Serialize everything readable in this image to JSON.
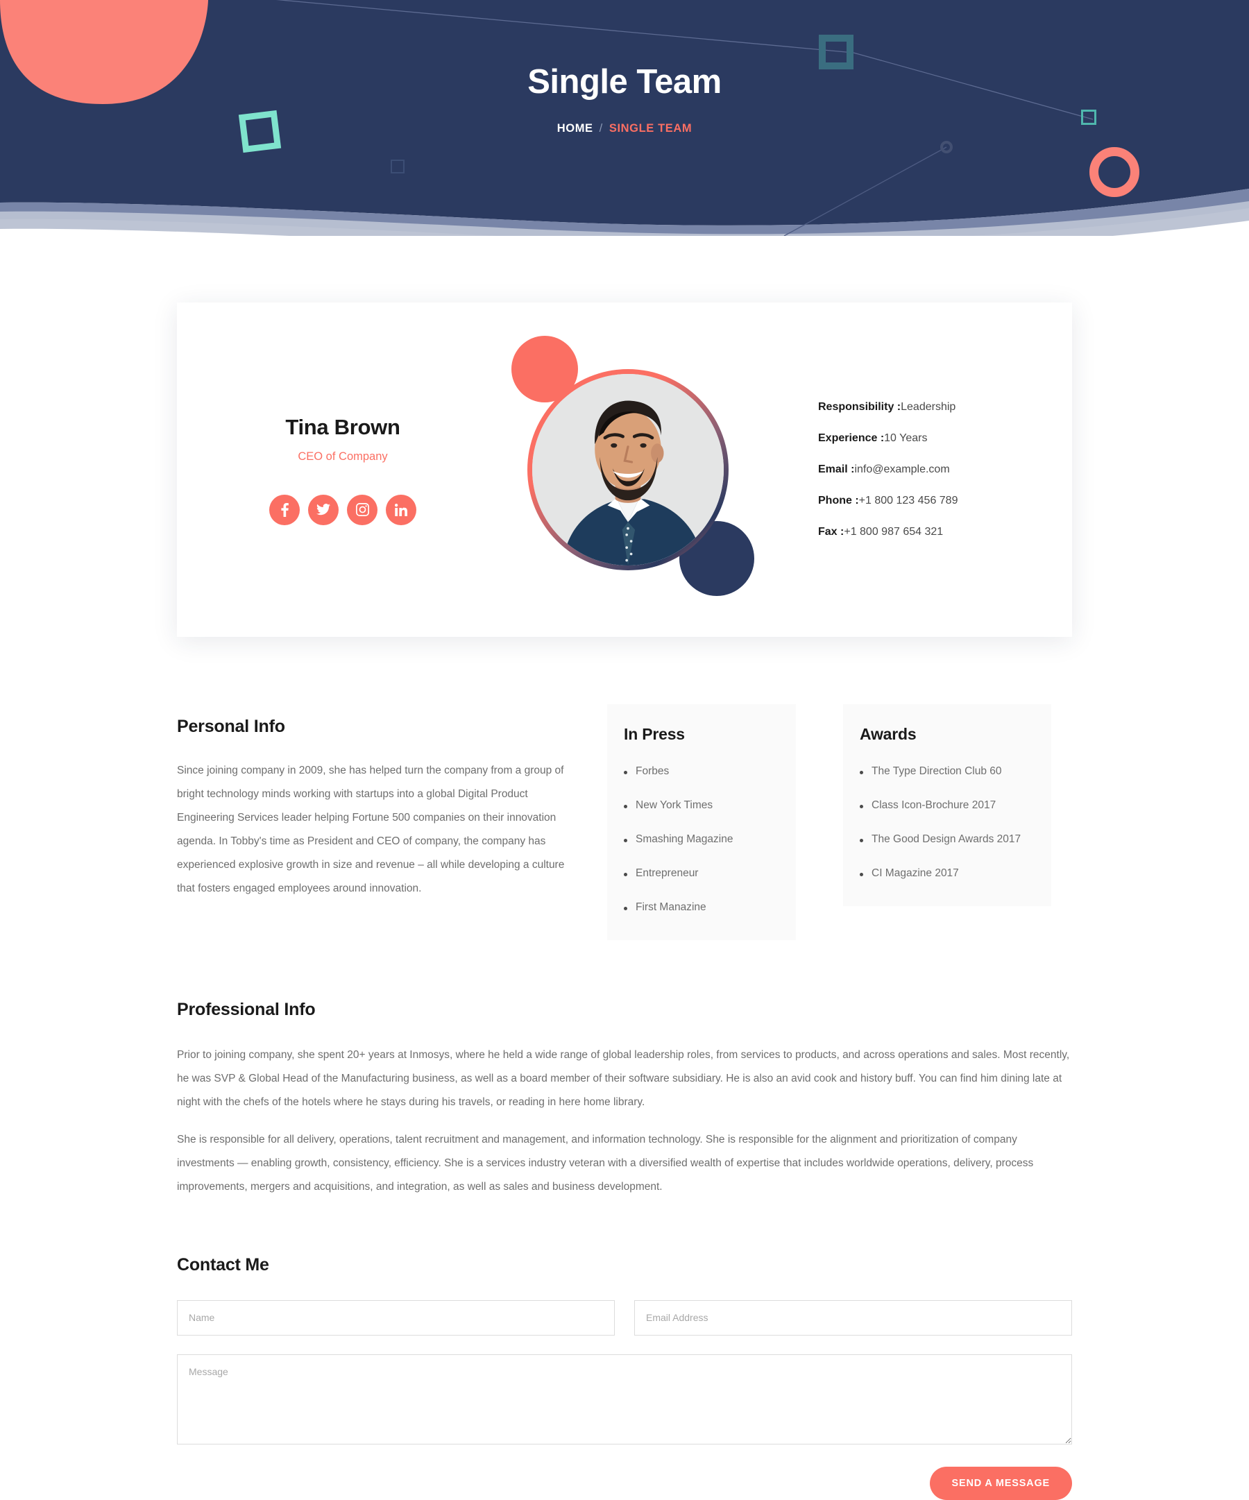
{
  "hero": {
    "title": "Single Team",
    "breadcrumb": {
      "home": "HOME",
      "separator": "/",
      "current": "SINGLE TEAM"
    },
    "colors": {
      "navy": "#2b3a60",
      "coral": "#fb6f63",
      "teal": "#7fe3cd",
      "steel": "#3a6d80",
      "wave_mid": "#6c7ba1",
      "wave_light": "#b9c1d2"
    }
  },
  "profile": {
    "name": "Tina Brown",
    "role": "CEO of Company",
    "social": [
      {
        "name": "facebook-icon",
        "label": "Facebook"
      },
      {
        "name": "twitter-icon",
        "label": "Twitter"
      },
      {
        "name": "instagram-icon",
        "label": "Instagram"
      },
      {
        "name": "linkedin-icon",
        "label": "LinkedIn"
      }
    ],
    "details": [
      {
        "label": "Responsibility :",
        "value": "Leadership"
      },
      {
        "label": "Experience :",
        "value": "10 Years"
      },
      {
        "label": "Email :",
        "value": "info@example.com"
      },
      {
        "label": "Phone :",
        "value": "+1 800 123 456 789"
      },
      {
        "label": "Fax :",
        "value": "+1 800 987 654 321"
      }
    ]
  },
  "personal_info": {
    "heading": "Personal Info",
    "paragraph": "Since joining company in 2009, she has helped turn the company from a group of bright technology minds working with startups into a global Digital Product Engineering Services leader helping Fortune 500 companies on their innovation agenda. In Tobby's time as President and CEO of company, the company has experienced explosive growth in size and revenue – all while developing a culture that fosters engaged employees around innovation."
  },
  "in_press": {
    "heading": "In Press",
    "items": [
      "Forbes",
      "New York Times",
      "Smashing Magazine",
      "Entrepreneur",
      "First Manazine"
    ]
  },
  "awards": {
    "heading": "Awards",
    "items": [
      "The Type Direction Club 60",
      "Class Icon-Brochure 2017",
      "The Good Design Awards 2017",
      "CI Magazine 2017"
    ]
  },
  "professional_info": {
    "heading": "Professional Info",
    "paragraph_1": "Prior to joining company, she spent 20+ years at Inmosys, where he held a wide range of global leadership roles, from services to products, and across operations and sales. Most recently, he was SVP & Global Head of the Manufacturing business, as well as a board member of their software subsidiary. He is also an avid cook and history buff. You can find him dining late at night with the chefs of the hotels where he stays during his travels, or reading in here home library.",
    "paragraph_2": "She is responsible for all delivery, operations, talent recruitment and management, and information technology. She is responsible for the alignment and prioritization of company investments — enabling growth, consistency, efficiency. She is a services industry veteran with a diversified wealth of expertise that includes worldwide operations, delivery, process improvements, mergers and acquisitions, and integration, as well as sales and business development."
  },
  "contact": {
    "heading": "Contact Me",
    "name_placeholder": "Name",
    "name_value": "",
    "email_placeholder": "Email Address",
    "email_value": "",
    "message_placeholder": "Message",
    "message_value": "",
    "submit_label": "SEND A MESSAGE"
  }
}
